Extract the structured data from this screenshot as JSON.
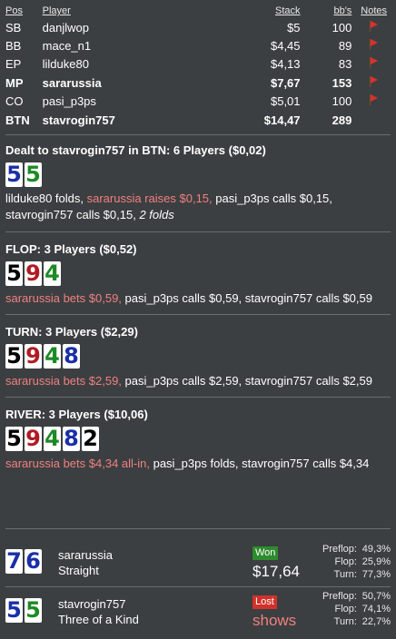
{
  "header": {
    "pos": "Pos",
    "player": "Player",
    "stack": "Stack",
    "bbs": "bb's",
    "notes": "Notes"
  },
  "players": [
    {
      "pos": "SB",
      "name": "danjlwop",
      "stack": "$5",
      "bbs": "100",
      "flag": true,
      "bold": false
    },
    {
      "pos": "BB",
      "name": "mace_n1",
      "stack": "$4,45",
      "bbs": "89",
      "flag": true,
      "bold": false
    },
    {
      "pos": "EP",
      "name": "lilduke80",
      "stack": "$4,13",
      "bbs": "83",
      "flag": true,
      "bold": false
    },
    {
      "pos": "MP",
      "name": "sararussia",
      "stack": "$7,67",
      "bbs": "153",
      "flag": true,
      "bold": true
    },
    {
      "pos": "CO",
      "name": "pasi_p3ps",
      "stack": "$5,01",
      "bbs": "100",
      "flag": true,
      "bold": false
    },
    {
      "pos": "BTN",
      "name": "stavrogin757",
      "stack": "$14,47",
      "bbs": "289",
      "flag": false,
      "bold": true
    }
  ],
  "preflop": {
    "title": "Dealt to stavrogin757 in BTN: 6 Players ($0,02)",
    "cards": [
      {
        "r": "5",
        "c": "blue"
      },
      {
        "r": "5",
        "c": "green"
      }
    ],
    "a1": "lilduke80 folds, ",
    "a2": "sararussia raises $0,15,",
    "a3": " pasi_p3ps calls $0,15,",
    "a4": "stavrogin757 calls $0,15, ",
    "a5": "2 folds"
  },
  "flop": {
    "title": "FLOP: 3 Players ($0,52)",
    "cards": [
      {
        "r": "5",
        "c": "black"
      },
      {
        "r": "9",
        "c": "red"
      },
      {
        "r": "4",
        "c": "green"
      }
    ],
    "a1": "sararussia bets $0,59,",
    "a2": " pasi_p3ps calls $0,59, stavrogin757 calls $0,59"
  },
  "turn": {
    "title": "TURN: 3 Players ($2,29)",
    "cards": [
      {
        "r": "5",
        "c": "black"
      },
      {
        "r": "9",
        "c": "red"
      },
      {
        "r": "4",
        "c": "green"
      },
      {
        "r": "8",
        "c": "blue"
      }
    ],
    "a1": "sararussia bets $2,59,",
    "a2": " pasi_p3ps calls $2,59, stavrogin757 calls $2,59"
  },
  "river": {
    "title": "RIVER: 3 Players ($10,06)",
    "cards": [
      {
        "r": "5",
        "c": "black"
      },
      {
        "r": "9",
        "c": "red"
      },
      {
        "r": "4",
        "c": "green"
      },
      {
        "r": "8",
        "c": "blue"
      },
      {
        "r": "2",
        "c": "black"
      }
    ],
    "a1": "sararussia bets $4,34 all-in,",
    "a2": " pasi_p3ps folds, stavrogin757 calls $4,34"
  },
  "results": [
    {
      "cards": [
        {
          "r": "7",
          "c": "blue"
        },
        {
          "r": "6",
          "c": "blue"
        }
      ],
      "name": "sararussia",
      "hand": "Straight",
      "badge": "Won",
      "amount": "$17,64",
      "pre_l": "Preflop:",
      "pre_v": "49,3%",
      "flop_l": "Flop:",
      "flop_v": "25,9%",
      "turn_l": "Turn:",
      "turn_v": "77,3%"
    },
    {
      "cards": [
        {
          "r": "5",
          "c": "blue"
        },
        {
          "r": "5",
          "c": "green"
        }
      ],
      "name": "stavrogin757",
      "hand": "Three of a Kind",
      "badge": "Lost",
      "amount": "shows",
      "pre_l": "Preflop:",
      "pre_v": "50,7%",
      "flop_l": "Flop:",
      "flop_v": "74,1%",
      "turn_l": "Turn:",
      "turn_v": "22,7%"
    }
  ]
}
